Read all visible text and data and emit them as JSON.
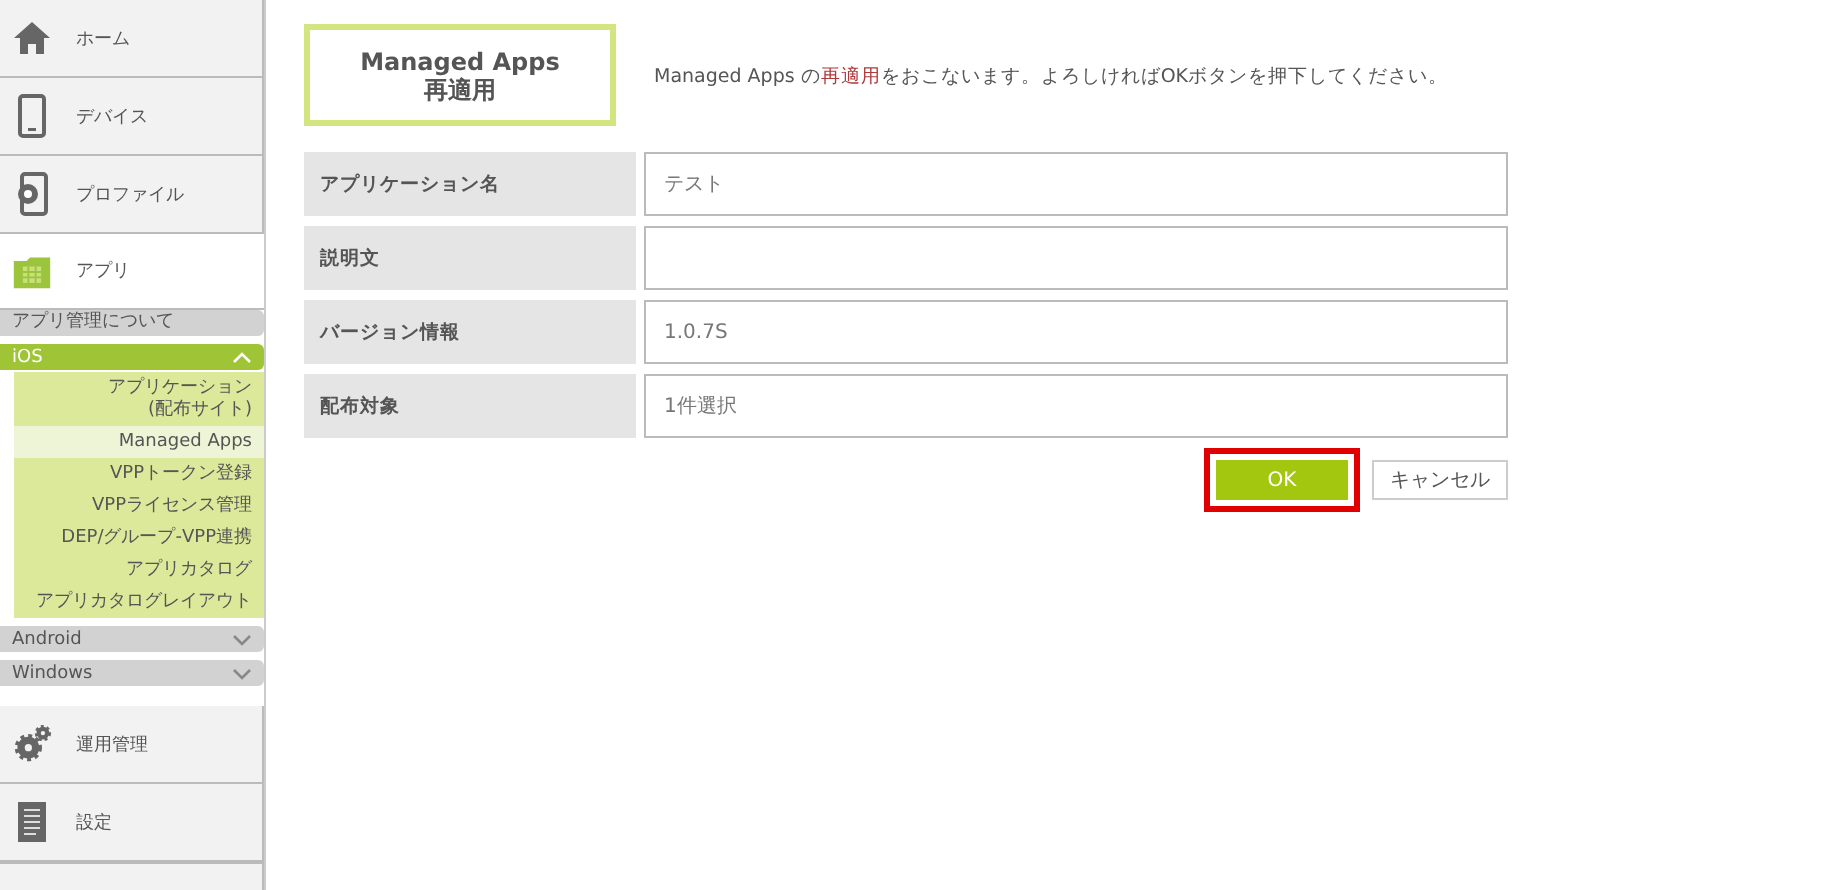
{
  "sidebar": {
    "items": [
      {
        "label": "ホーム",
        "selected": false
      },
      {
        "label": "デバイス",
        "selected": false
      },
      {
        "label": "プロファイル",
        "selected": false
      },
      {
        "label": "アプリ",
        "selected": true,
        "groups": [
          {
            "label": "アプリ管理について",
            "kind": "link"
          },
          {
            "label": "iOS",
            "kind": "platform",
            "expanded": true,
            "children": [
              {
                "label": "アプリケーション\n(配布サイト)",
                "selected": false
              },
              {
                "label": "Managed Apps",
                "selected": true
              },
              {
                "label": "VPPトークン登録",
                "selected": false
              },
              {
                "label": "VPPライセンス管理",
                "selected": false
              },
              {
                "label": "DEP/グループ-VPP連携",
                "selected": false
              },
              {
                "label": "アプリカタログ",
                "selected": false
              },
              {
                "label": "アプリカタログレイアウト",
                "selected": false
              }
            ]
          },
          {
            "label": "Android",
            "kind": "platform",
            "expanded": false
          },
          {
            "label": "Windows",
            "kind": "platform",
            "expanded": false
          }
        ]
      },
      {
        "label": "運用管理",
        "selected": false
      },
      {
        "label": "設定",
        "selected": false
      }
    ]
  },
  "header": {
    "title": "Managed Apps\n再適用",
    "message": "Managed Apps の**再適用**をおこないます。よろしければOKボタンを押下してください。"
  },
  "form": {
    "rows": [
      {
        "label": "アプリケーション名",
        "value": "テスト"
      },
      {
        "label": "説明文"
      },
      {
        "label": "バージョン情報",
        "value": "1.0.7S"
      },
      {
        "label": "配布対象",
        "value": "1件選択"
      }
    ]
  },
  "buttons": [
    {
      "label": "OK",
      "kind": "primary",
      "highlighted": true
    },
    {
      "label": "キャンセル",
      "kind": "secondary",
      "highlighted": false
    }
  ]
}
